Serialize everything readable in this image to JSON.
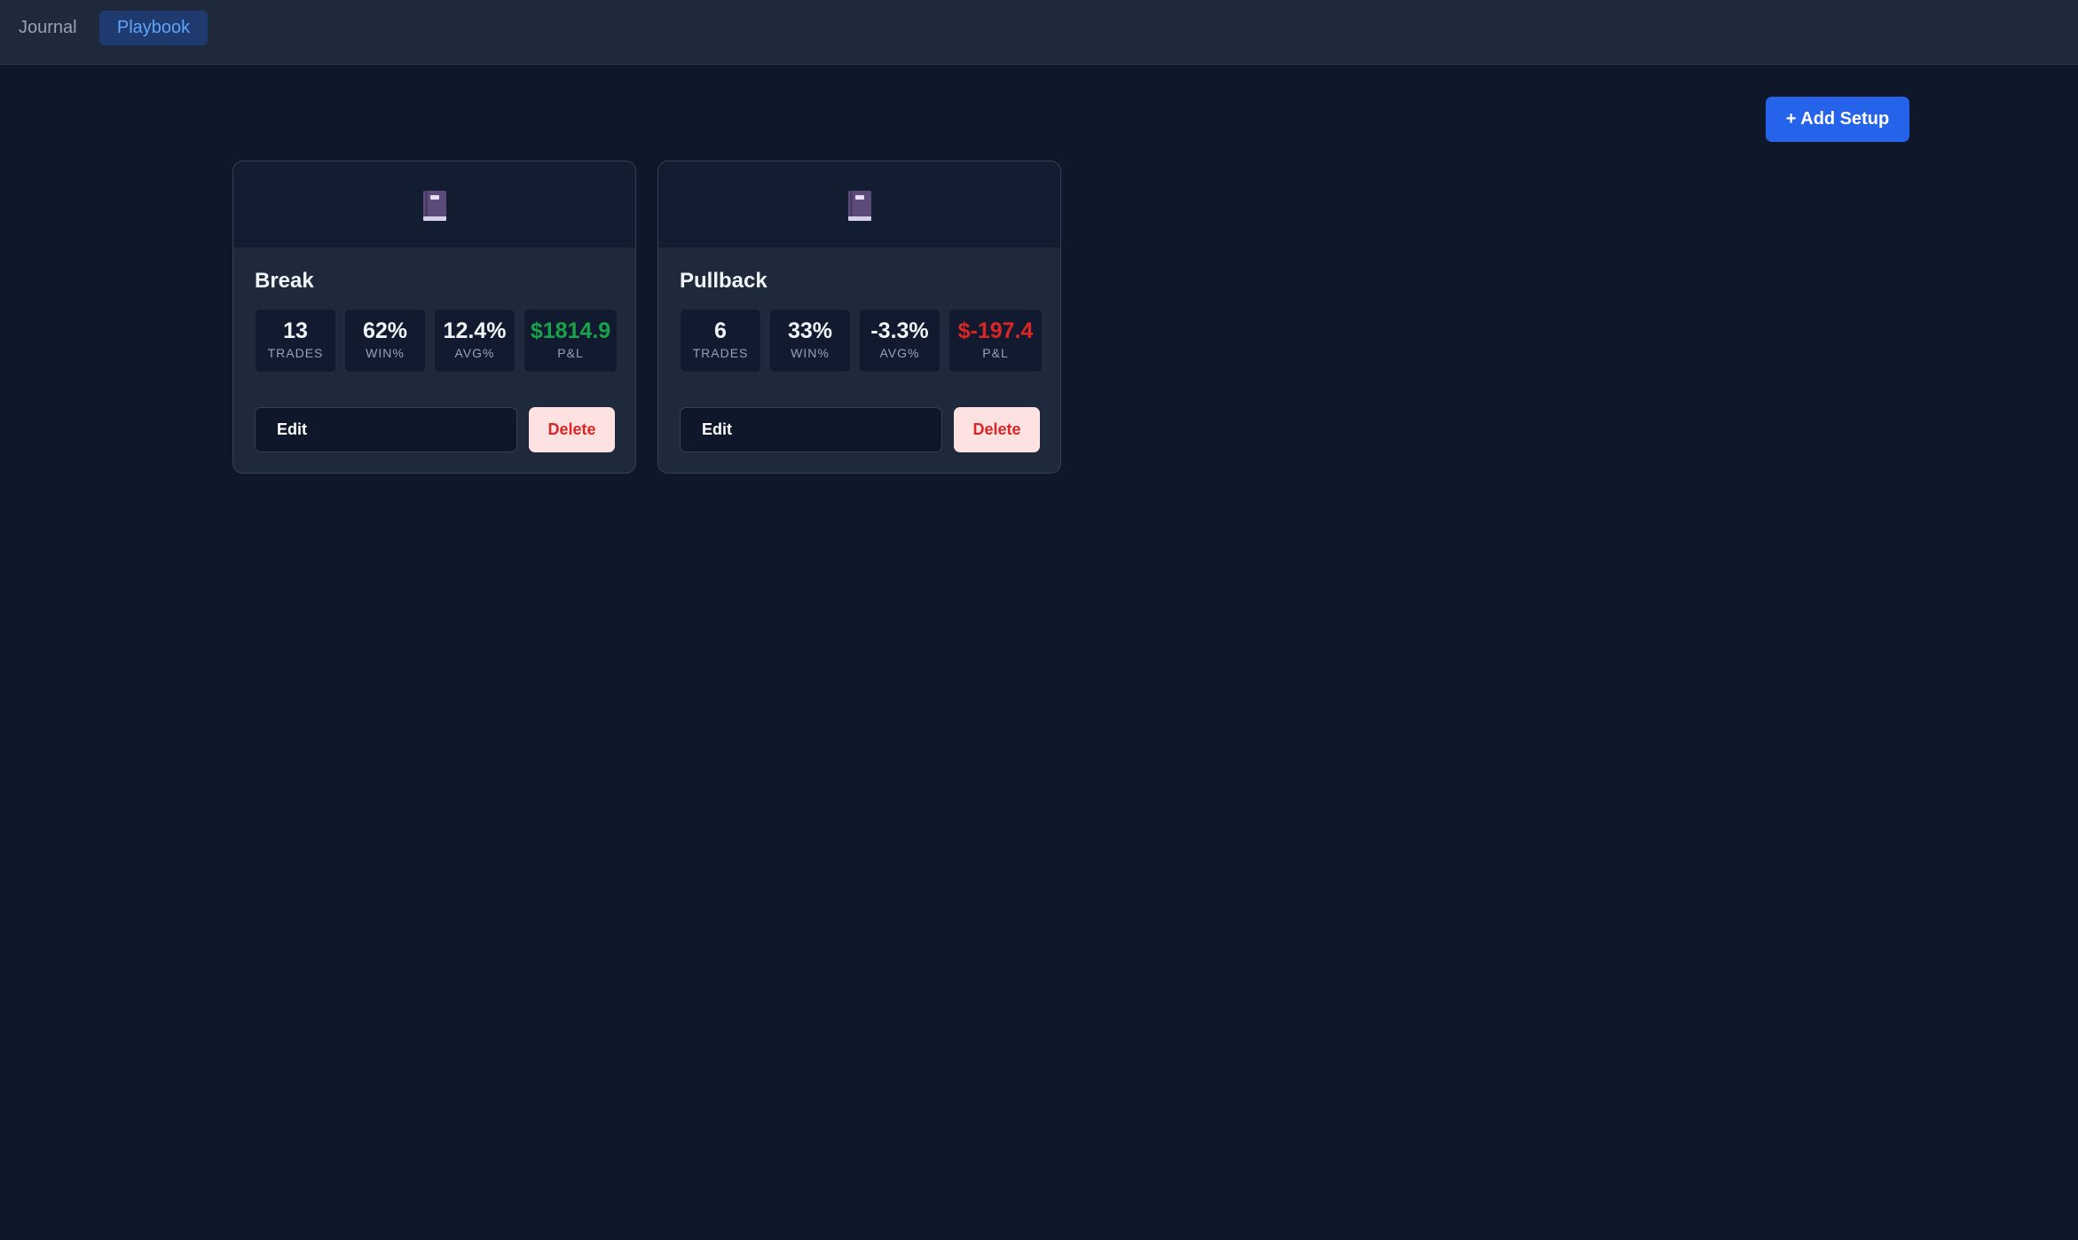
{
  "nav": {
    "tabs": [
      {
        "label": "Journal",
        "active": false
      },
      {
        "label": "Playbook",
        "active": true
      }
    ]
  },
  "toolbar": {
    "add_label": "+ Add Setup"
  },
  "colors": {
    "accent": "#2563eb",
    "positive": "#16a34a",
    "negative": "#dc2626",
    "delete_text": "#dc2626"
  },
  "stat_labels": {
    "trades": "TRADES",
    "win": "WIN%",
    "avg": "AVG%",
    "pnl": "P&L"
  },
  "setups": [
    {
      "icon": "book-icon",
      "name": "Break",
      "trades": "13",
      "win_pct": "62%",
      "avg_pct": "12.4%",
      "pnl": "$1814.9",
      "pnl_status": "positive",
      "edit_label": "Edit",
      "delete_label": "Delete"
    },
    {
      "icon": "book-icon",
      "name": "Pullback",
      "trades": "6",
      "win_pct": "33%",
      "avg_pct": "-3.3%",
      "pnl": "$-197.4",
      "pnl_status": "negative",
      "edit_label": "Edit",
      "delete_label": "Delete"
    }
  ]
}
